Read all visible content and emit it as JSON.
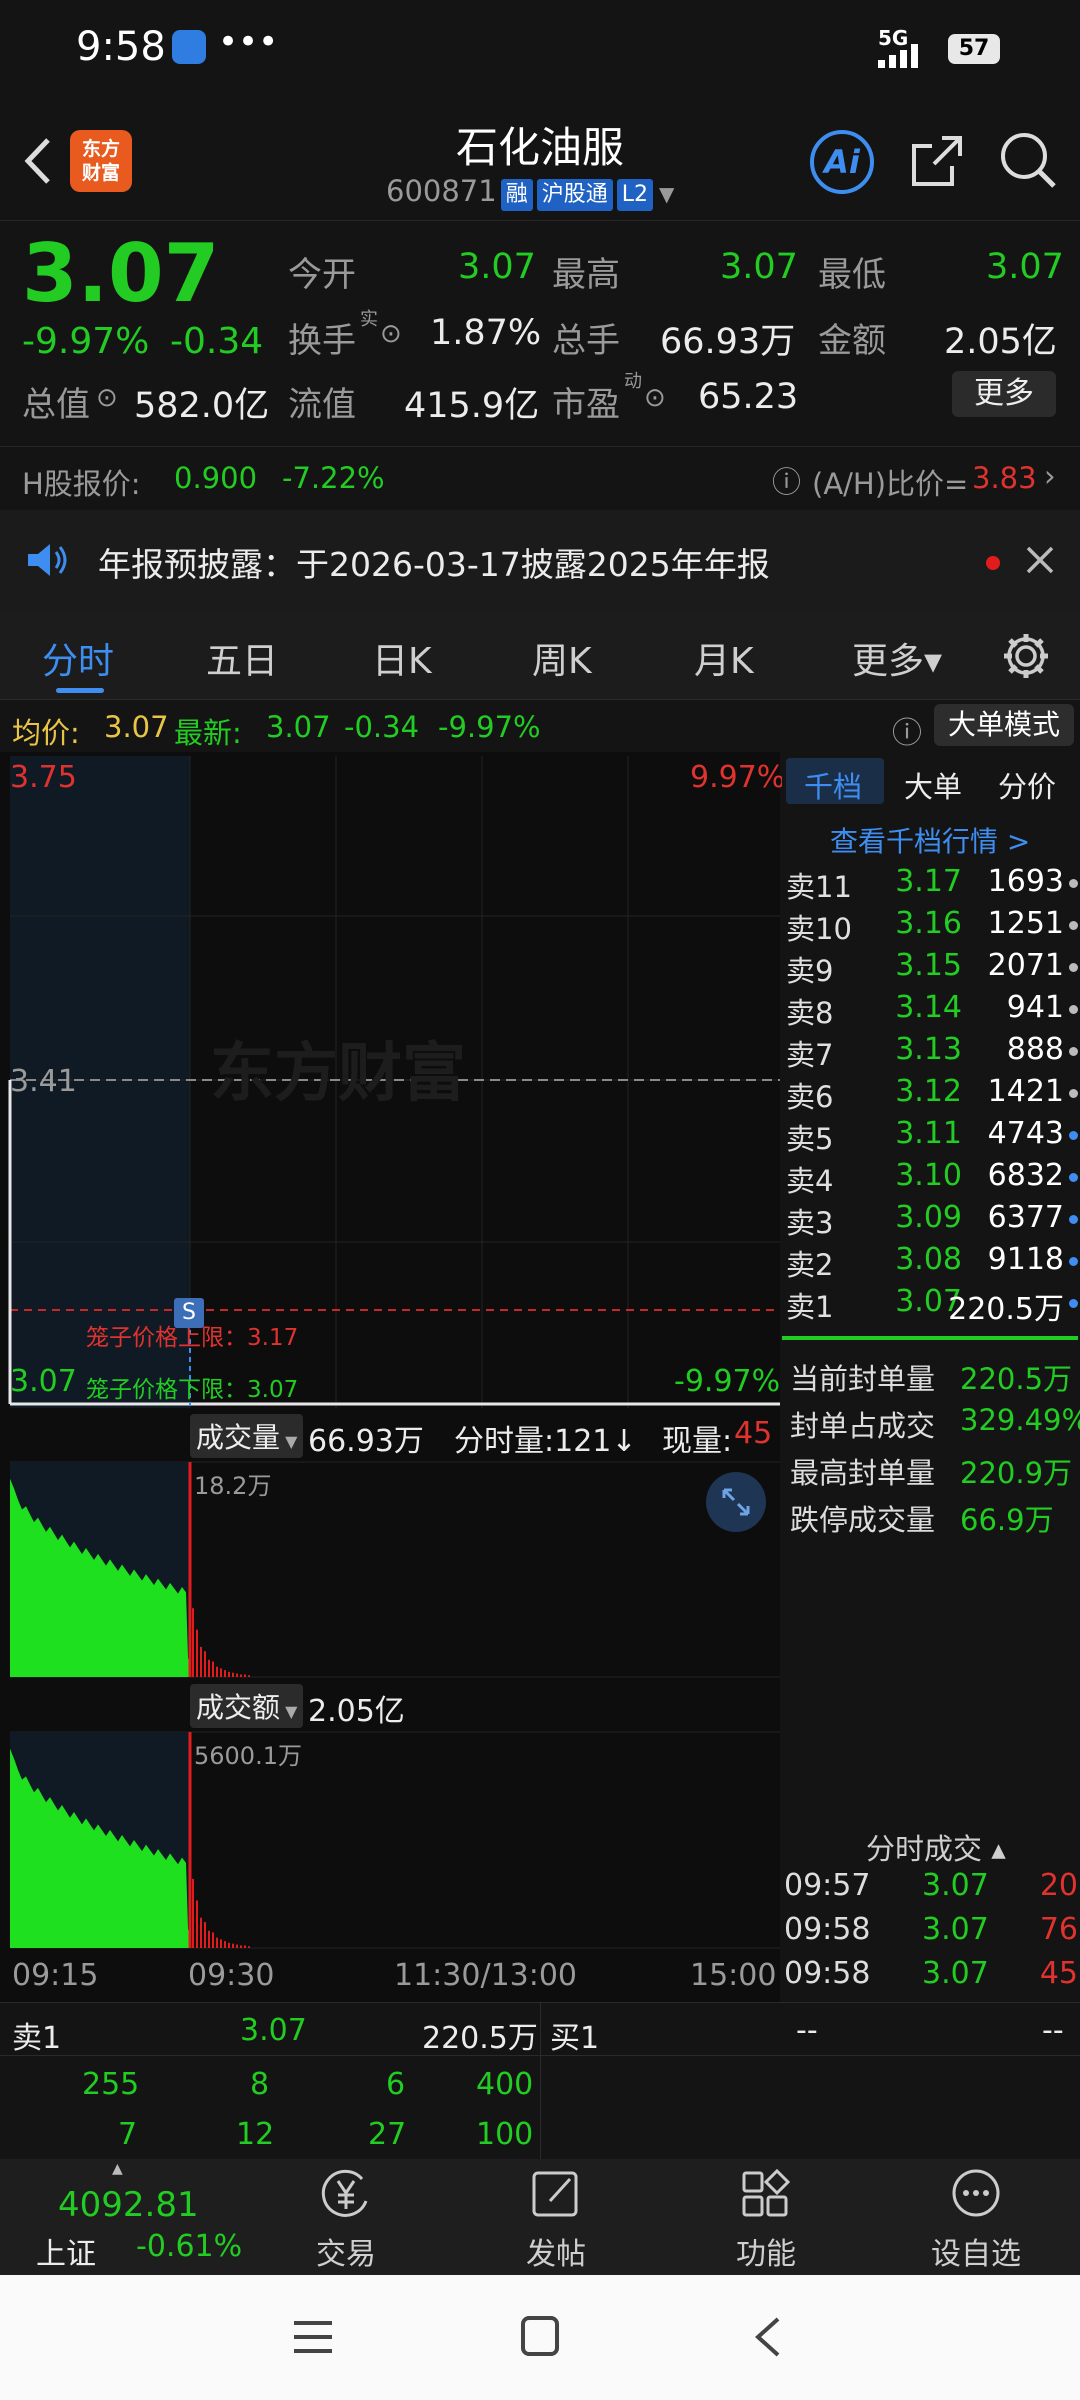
{
  "status": {
    "time": "9:58",
    "dots": "•••",
    "network": "5G",
    "battery": "57"
  },
  "header": {
    "title": "石化油服",
    "code": "600871",
    "tags": [
      "融",
      "沪股通",
      "L2"
    ],
    "logo": "东方\n财富",
    "ai_label": "Ai"
  },
  "quote": {
    "price": "3.07",
    "change_pct": "-9.97%",
    "change": "-0.34",
    "open_label": "今开",
    "open": "3.07",
    "high_label": "最高",
    "high": "3.07",
    "low_label": "最低",
    "low": "3.07",
    "turnover_label": "换手",
    "turnover_sup": "实",
    "turnover": "1.87%",
    "volume_label": "总手",
    "volume": "66.93万",
    "amount_label": "金额",
    "amount": "2.05亿",
    "mktcap_label": "总值",
    "mktcap": "582.0亿",
    "float_label": "流值",
    "float": "415.9亿",
    "pe_label": "市盈",
    "pe_sup": "动",
    "pe": "65.23",
    "more": "更多"
  },
  "hshare": {
    "label": "H股报价:",
    "price": "0.900",
    "pct": "-7.22%",
    "ah_label": "(A/H)比价=",
    "ah_value": "3.83"
  },
  "notice": {
    "text": "年报预披露：于2026-03-17披露2025年年报"
  },
  "tabs": [
    "分时",
    "五日",
    "日K",
    "周K",
    "月K",
    "更多▾"
  ],
  "info": {
    "avg_label": "均价:",
    "avg": "3.07",
    "latest_label": "最新:",
    "latest": "3.07",
    "chg": "-0.34",
    "pct": "-9.97%",
    "mode_btn": "大单模式"
  },
  "chart": {
    "top_price": "3.75",
    "top_pct": "9.97%",
    "mid_price": "3.41",
    "bottom_price": "3.07",
    "bottom_pct": "-9.97%",
    "cage_upper": "笼子价格上限：3.17",
    "cage_lower": "笼子价格下限：3.07",
    "watermark": "东方财富",
    "marker": "S",
    "vol_label": "成交量",
    "vol_value": "66.93万",
    "tick_label": "分时量:121↓",
    "now_label": "现量:",
    "now_value": "45",
    "vol_max": "18.2万",
    "amt_label": "成交额",
    "amt_value": "2.05亿",
    "amt_max": "5600.1万",
    "times": [
      "09:15",
      "09:30",
      "11:30/13:00",
      "15:00"
    ]
  },
  "book": {
    "tabs": [
      "千档",
      "大单",
      "分价"
    ],
    "link": "查看千档行情 >",
    "asks": [
      {
        "label": "卖11",
        "price": "3.17",
        "vol": "1693",
        "dot": "#bbbbbb"
      },
      {
        "label": "卖10",
        "price": "3.16",
        "vol": "1251",
        "dot": "#bbbbbb"
      },
      {
        "label": "卖9",
        "price": "3.15",
        "vol": "2071",
        "dot": "#bbbbbb"
      },
      {
        "label": "卖8",
        "price": "3.14",
        "vol": "941",
        "dot": "#bbbbbb"
      },
      {
        "label": "卖7",
        "price": "3.13",
        "vol": "888",
        "dot": "#bbbbbb"
      },
      {
        "label": "卖6",
        "price": "3.12",
        "vol": "1421",
        "dot": "#bbbbbb"
      },
      {
        "label": "卖5",
        "price": "3.11",
        "vol": "4743",
        "dot": "#3d8ef0"
      },
      {
        "label": "卖4",
        "price": "3.10",
        "vol": "6832",
        "dot": "#3d8ef0"
      },
      {
        "label": "卖3",
        "price": "3.09",
        "vol": "6377",
        "dot": "#3d8ef0"
      },
      {
        "label": "卖2",
        "price": "3.08",
        "vol": "9118",
        "dot": "#3d8ef0"
      },
      {
        "label": "卖1",
        "price": "3.07",
        "vol": "220.5万",
        "dot": "#3d8ef0"
      }
    ],
    "seal": [
      {
        "label": "当前封单量",
        "value": "220.5万"
      },
      {
        "label": "封单占成交",
        "value": "329.49%"
      },
      {
        "label": "最高封单量",
        "value": "220.9万"
      },
      {
        "label": "跌停成交量",
        "value": "66.9万"
      }
    ],
    "trades_title": "分时成交 ▴",
    "trades": [
      {
        "time": "09:57",
        "price": "3.07",
        "vol": "20"
      },
      {
        "time": "09:58",
        "price": "3.07",
        "vol": "76"
      },
      {
        "time": "09:58",
        "price": "3.07",
        "vol": "45"
      }
    ]
  },
  "bottom": {
    "sell_label": "卖1",
    "sell_price": "3.07",
    "sell_vol": "220.5万",
    "buy_label": "买1",
    "buy_price": "--",
    "buy_vol": "--",
    "row1": [
      "255",
      "8",
      "6",
      "400"
    ],
    "row2": [
      "7",
      "12",
      "27",
      "100"
    ]
  },
  "toolbar": {
    "index_value": "4092.81",
    "index_name": "上证",
    "index_pct": "-0.61%",
    "items": [
      "交易",
      "发帖",
      "功能",
      "设自选"
    ]
  }
}
